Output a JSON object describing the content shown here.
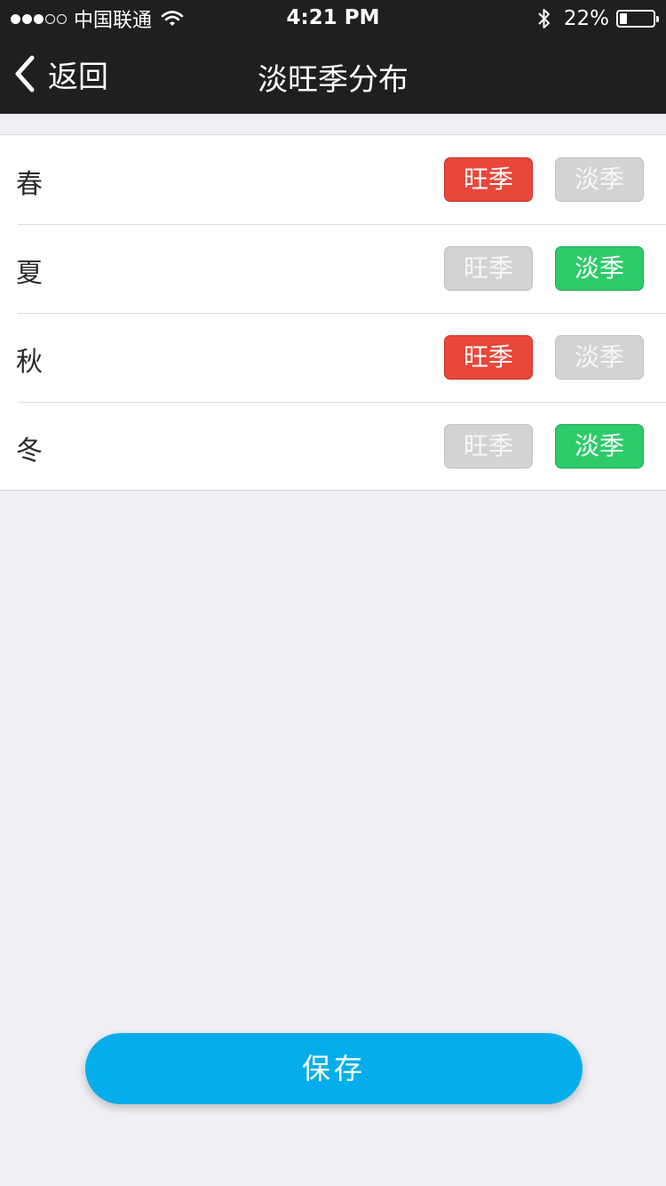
{
  "status_bar": {
    "carrier": "中国联通",
    "time": "4:21 PM",
    "battery_percent": "22%",
    "battery_level": 0.22,
    "signal_bars": [
      true,
      true,
      true,
      false,
      false
    ],
    "icons": [
      "signal-dots-icon",
      "wifi-icon",
      "bluetooth-icon",
      "battery-icon"
    ]
  },
  "nav": {
    "back_label": "返回",
    "back_icon": "chevron-left-icon",
    "title": "淡旺季分布"
  },
  "seasons": [
    {
      "name": "春",
      "peak_label": "旺季",
      "off_label": "淡季",
      "selected": "peak"
    },
    {
      "name": "夏",
      "peak_label": "旺季",
      "off_label": "淡季",
      "selected": "off"
    },
    {
      "name": "秋",
      "peak_label": "旺季",
      "off_label": "淡季",
      "selected": "peak"
    },
    {
      "name": "冬",
      "peak_label": "旺季",
      "off_label": "淡季",
      "selected": "off"
    }
  ],
  "colors": {
    "peak_active": "#e8473a",
    "off_active": "#2ecb6a",
    "inactive": "#d3d3d5",
    "save": "#05aeea",
    "bar": "#1f1f21"
  },
  "save_label": "保存"
}
